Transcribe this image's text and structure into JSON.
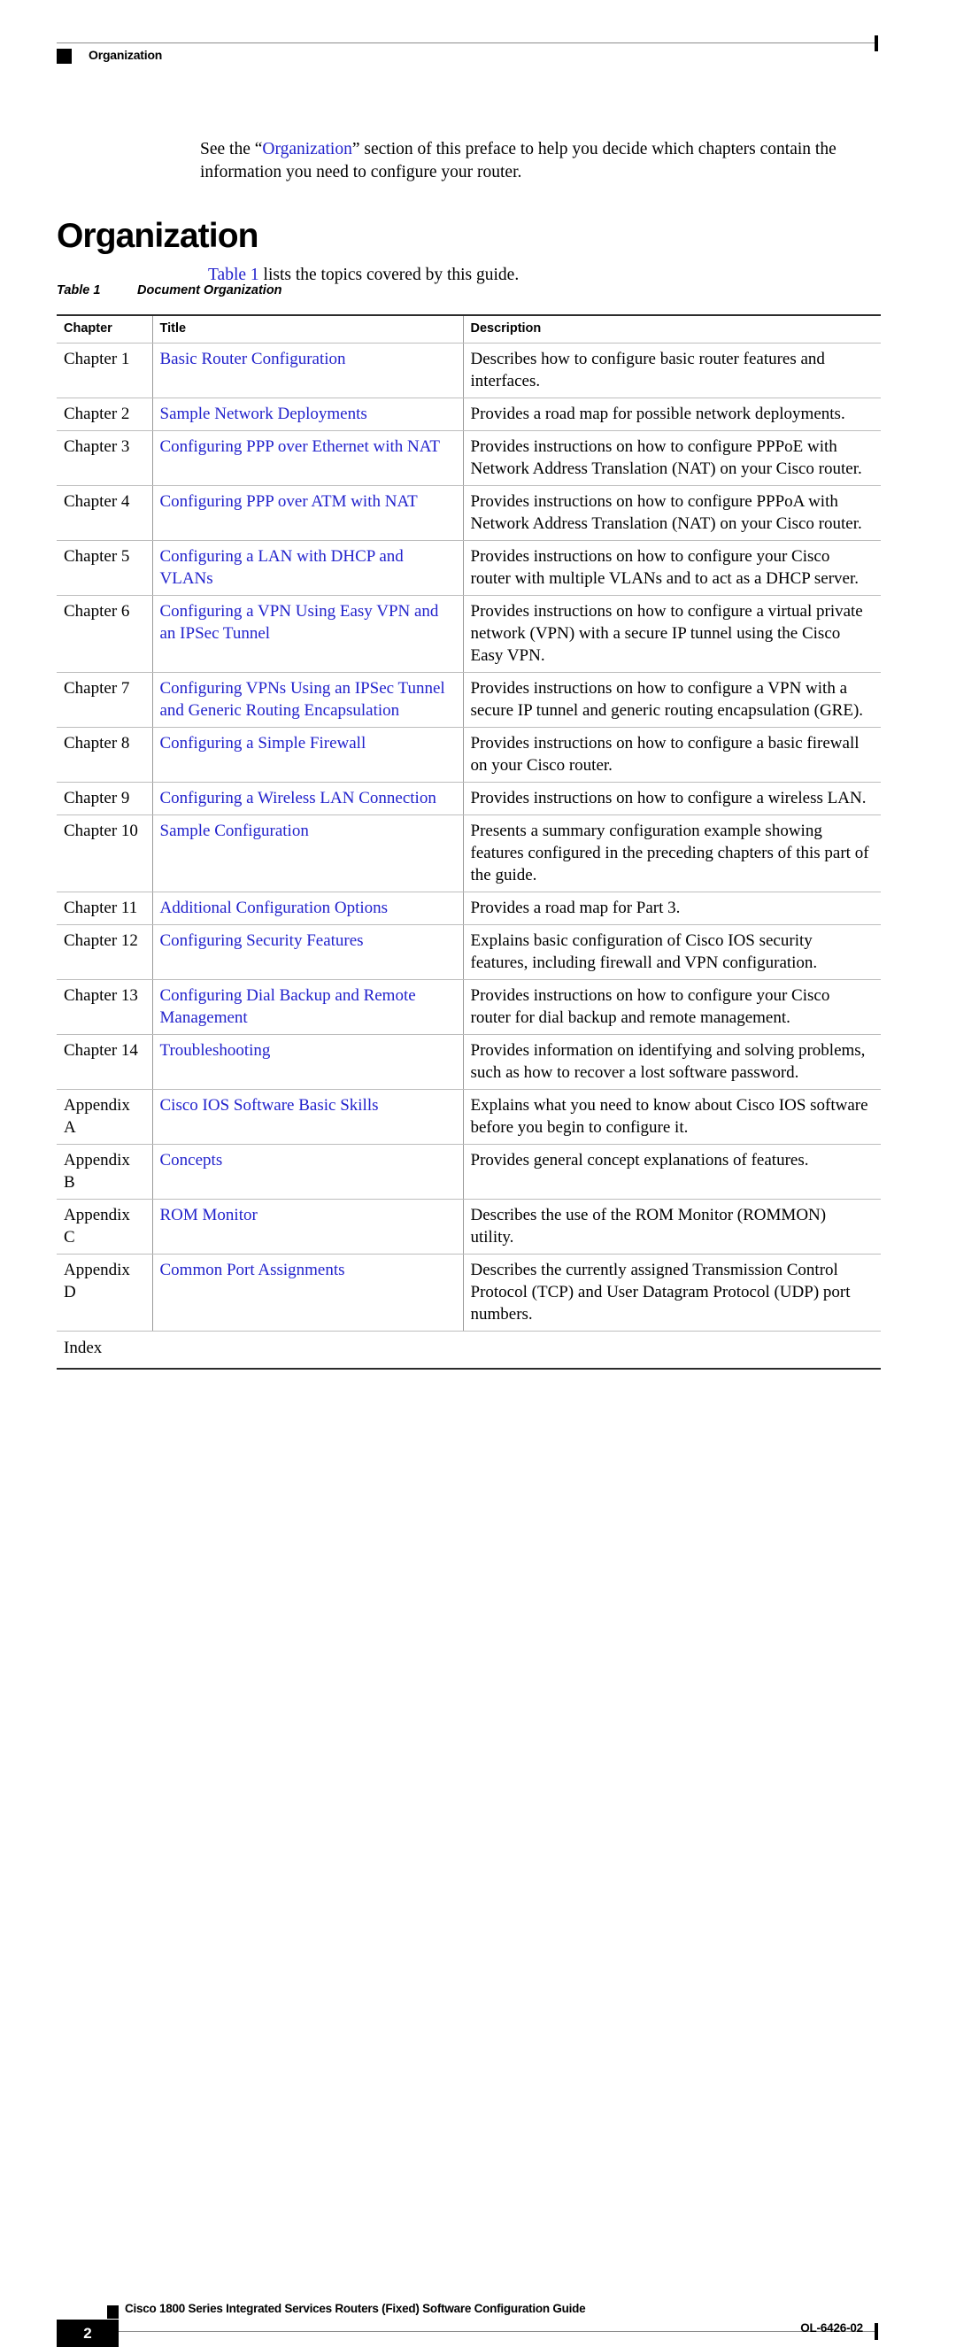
{
  "header": {
    "running_head": "Organization",
    "marker_icon": "black-square-icon"
  },
  "intro": {
    "before_link": "See the “",
    "link": "Organization",
    "after_link": "” section of this preface to help you decide which chapters contain the information you need to configure your router."
  },
  "section": {
    "heading": "Organization"
  },
  "table_lead": {
    "link": "Table 1",
    "text": " lists the topics covered by this guide."
  },
  "table_caption": {
    "number": "Table 1",
    "title": "Document Organization"
  },
  "table": {
    "columns": [
      "Chapter",
      "Title",
      "Description"
    ],
    "rows": [
      {
        "chapter": "Chapter 1",
        "title": "Basic Router Configuration",
        "description": "Describes how to configure basic router features and interfaces."
      },
      {
        "chapter": "Chapter 2",
        "title": "Sample Network Deployments",
        "description": "Provides a road map for possible network deployments."
      },
      {
        "chapter": "Chapter 3",
        "title": "Configuring PPP over Ethernet with NAT",
        "description": "Provides instructions on how to configure PPPoE with Network Address Translation (NAT) on your Cisco router."
      },
      {
        "chapter": "Chapter 4",
        "title": "Configuring PPP over ATM with NAT",
        "description": "Provides instructions on how to configure PPPoA with Network Address Translation (NAT) on your Cisco router."
      },
      {
        "chapter": "Chapter 5",
        "title": "Configuring a LAN with DHCP and VLANs",
        "description": "Provides instructions on how to configure your Cisco router with multiple VLANs and to act as a DHCP server."
      },
      {
        "chapter": "Chapter 6",
        "title": "Configuring a VPN Using Easy VPN and an IPSec Tunnel",
        "description": "Provides instructions on how to configure a virtual private network (VPN) with a secure IP tunnel using the Cisco Easy VPN."
      },
      {
        "chapter": "Chapter 7",
        "title": "Configuring VPNs Using an IPSec Tunnel and Generic Routing Encapsulation",
        "description": "Provides instructions on how to configure a VPN with a secure IP tunnel and generic routing encapsulation (GRE)."
      },
      {
        "chapter": "Chapter 8",
        "title": "Configuring a Simple Firewall",
        "description": "Provides instructions on how to configure a basic firewall on your Cisco router."
      },
      {
        "chapter": "Chapter 9",
        "title": "Configuring a Wireless LAN Connection",
        "description": "Provides instructions on how to configure a wireless LAN."
      },
      {
        "chapter": "Chapter 10",
        "title": "Sample Configuration",
        "description": "Presents a summary configuration example showing features configured in the preceding chapters of this part of the guide."
      },
      {
        "chapter": "Chapter 11",
        "title": "Additional Configuration Options",
        "description": "Provides a road map for Part 3."
      },
      {
        "chapter": "Chapter 12",
        "title": "Configuring Security Features",
        "description": "Explains basic configuration of Cisco IOS security features, including firewall and VPN configuration."
      },
      {
        "chapter": "Chapter 13",
        "title": "Configuring Dial Backup and Remote Management",
        "description": "Provides instructions on how to configure your Cisco router for dial backup and remote management."
      },
      {
        "chapter": "Chapter 14",
        "title": "Troubleshooting",
        "description": "Provides information on identifying and solving problems, such as how to recover a lost software password."
      },
      {
        "chapter": "Appendix A",
        "title": "Cisco IOS Software Basic Skills",
        "description": "Explains what you need to know about Cisco IOS software before you begin to configure it."
      },
      {
        "chapter": "Appendix B",
        "title": "Concepts",
        "description": "Provides general concept explanations of features."
      },
      {
        "chapter": "Appendix C",
        "title": "ROM Monitor",
        "description": "Describes the use of the ROM Monitor (ROMMON) utility."
      },
      {
        "chapter": "Appendix D",
        "title": "Common Port Assignments",
        "description": "Describes the currently assigned Transmission Control Protocol (TCP) and User Datagram Protocol (UDP) port numbers."
      }
    ],
    "index_row": "Index"
  },
  "footer": {
    "page_number": "2",
    "marker_icon": "black-square-icon",
    "document_title": "Cisco 1800 Series Integrated Services Routers (Fixed) Software Configuration Guide",
    "document_id": "OL-6426-02"
  },
  "colors": {
    "link_blue": "#2222cc",
    "rule_dark": "#2b2b2b",
    "rule_light": "#bdbdbd",
    "marker_black": "#000000"
  }
}
